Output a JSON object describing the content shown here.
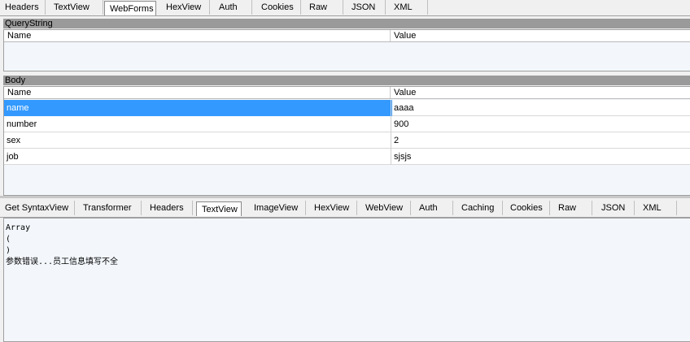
{
  "request_tabs": [
    "Headers",
    "TextView",
    "WebForms",
    "HexView",
    "Auth",
    "Cookies",
    "Raw",
    "JSON",
    "XML"
  ],
  "request_active_tab": "WebForms",
  "querystring": {
    "title": "QueryString",
    "col_name": "Name",
    "col_value": "Value",
    "rows": []
  },
  "body": {
    "title": "Body",
    "col_name": "Name",
    "col_value": "Value",
    "rows": [
      {
        "name": "name",
        "value": "aaaa"
      },
      {
        "name": "number",
        "value": "900"
      },
      {
        "name": "sex",
        "value": "2"
      },
      {
        "name": "job",
        "value": "sjsjs"
      }
    ]
  },
  "response_tabs": [
    "Get SyntaxView",
    "Transformer",
    "Headers",
    "TextView",
    "ImageView",
    "HexView",
    "WebView",
    "Auth",
    "Caching",
    "Cookies",
    "Raw",
    "JSON",
    "XML"
  ],
  "response_active_tab": "TextView",
  "textview": {
    "lines": [
      "Array",
      "(",
      ")",
      "参数错误...员工信息填写不全"
    ]
  },
  "colors": {
    "selection": "#3399ff",
    "grid_background": "#f3f7fc",
    "section_header": "#9a9a9a"
  }
}
